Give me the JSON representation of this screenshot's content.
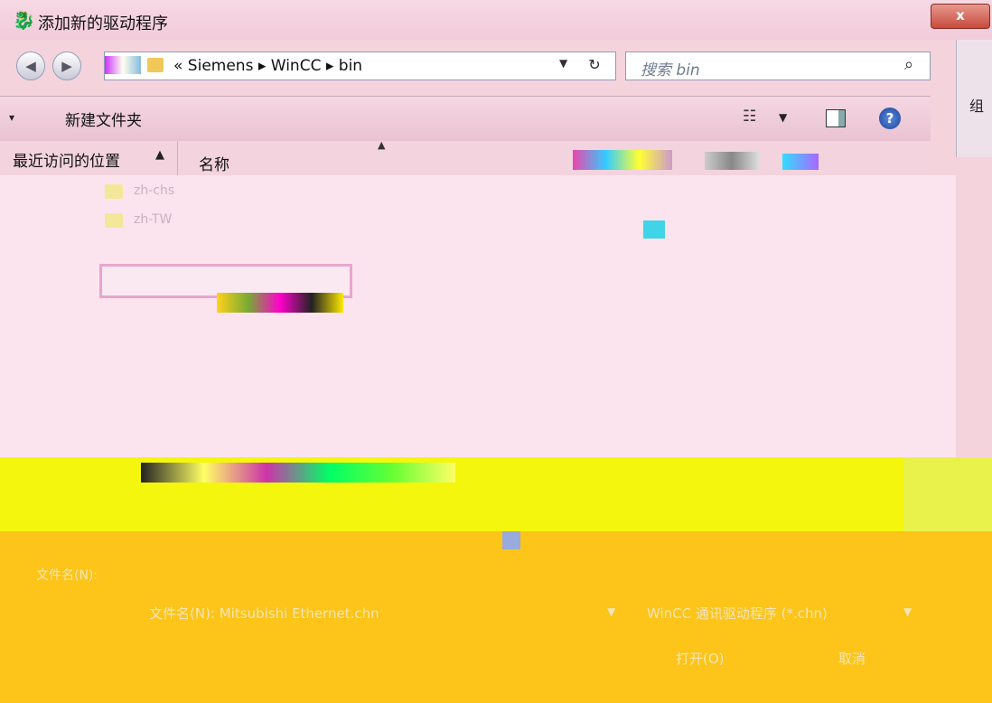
{
  "window": {
    "title": "添加新的驱动程序",
    "app_icon": "dragon-icon",
    "close_label": "x"
  },
  "nav": {
    "back_icon": "back-arrow-icon",
    "forward_icon": "forward-arrow-icon",
    "address_path": "« Siemens ▸ WinCC ▸ bin",
    "refresh_label": "↻",
    "search_placeholder": "搜索 bin",
    "right_frame_text": "组"
  },
  "toolbar": {
    "new_folder_label": "新建文件夹",
    "organize_arrow": "▾",
    "views_icon": "views-icon",
    "preview_pane_icon": "preview-pane-icon",
    "help_label": "?"
  },
  "columns": {
    "nav_pane_header": "最近访问的位置",
    "name_header": "名称"
  },
  "files": [
    {
      "name": "zh-chs"
    },
    {
      "name": "zh-TW"
    }
  ],
  "bottom": {
    "filename_label": "文件名(N):",
    "filename_value": "文件名(N): Mitsubishi Ethernet.chn",
    "filter_value": "WinCC 通讯驱动程序 (*.chn)",
    "open_label": "打开(O)",
    "cancel_label": "取消"
  },
  "colors": {
    "title_bg": "#f4d4e0",
    "close_red": "#c84a3c",
    "yellow_band": "#f4f60d",
    "orange_band": "#fdc419"
  }
}
